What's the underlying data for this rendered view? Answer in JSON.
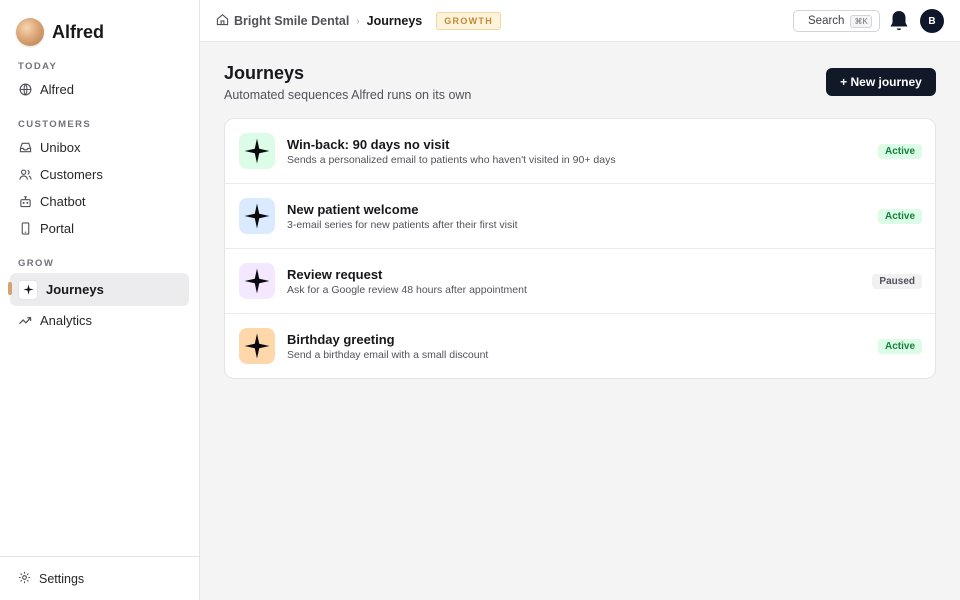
{
  "brand": {
    "name": "Alfred"
  },
  "sidebar": {
    "sections": [
      {
        "label": "TODAY"
      },
      {
        "label": "CUSTOMERS"
      },
      {
        "label": "GROW"
      }
    ],
    "items": [
      {
        "label": "Alfred",
        "icon": "globe-icon"
      },
      {
        "label": "Unibox",
        "icon": "inbox-icon"
      },
      {
        "label": "Customers",
        "icon": "users-icon"
      },
      {
        "label": "Chatbot",
        "icon": "bot-icon"
      },
      {
        "label": "Portal",
        "icon": "phone-icon"
      },
      {
        "label": "Journeys",
        "icon": "sparkle-icon",
        "active": true
      },
      {
        "label": "Analytics",
        "icon": "trending-icon"
      }
    ],
    "settings_label": "Settings"
  },
  "topbar": {
    "org": "Bright Smile Dental",
    "separator": "›",
    "page": "Journeys",
    "plan": "GROWTH",
    "search_label": "Search",
    "search_shortcut": "⌘K",
    "avatar_initial": "B"
  },
  "main": {
    "title": "Journeys",
    "subtitle": "Automated sequences Alfred runs on its own",
    "new_button": "+ New journey",
    "journeys": [
      {
        "title": "Win-back: 90 days no visit",
        "description": "Sends a personalized email to patients who haven't visited in 90+ days",
        "status": "Active",
        "icon_bg": "#dcfce7"
      },
      {
        "title": "New patient welcome",
        "description": "3-email series for new patients after their first visit",
        "status": "Active",
        "icon_bg": "#dbeafe"
      },
      {
        "title": "Review request",
        "description": "Ask for a Google review 48 hours after appointment",
        "status": "Paused",
        "icon_bg": "#f3e8ff"
      },
      {
        "title": "Birthday greeting",
        "description": "Send a birthday email with a small discount",
        "status": "Active",
        "icon_bg": "#fed7aa"
      }
    ]
  },
  "colors": {
    "accent_dark": "#111827",
    "active_status": "#15803d",
    "plan_badge": "#c28a2c"
  }
}
